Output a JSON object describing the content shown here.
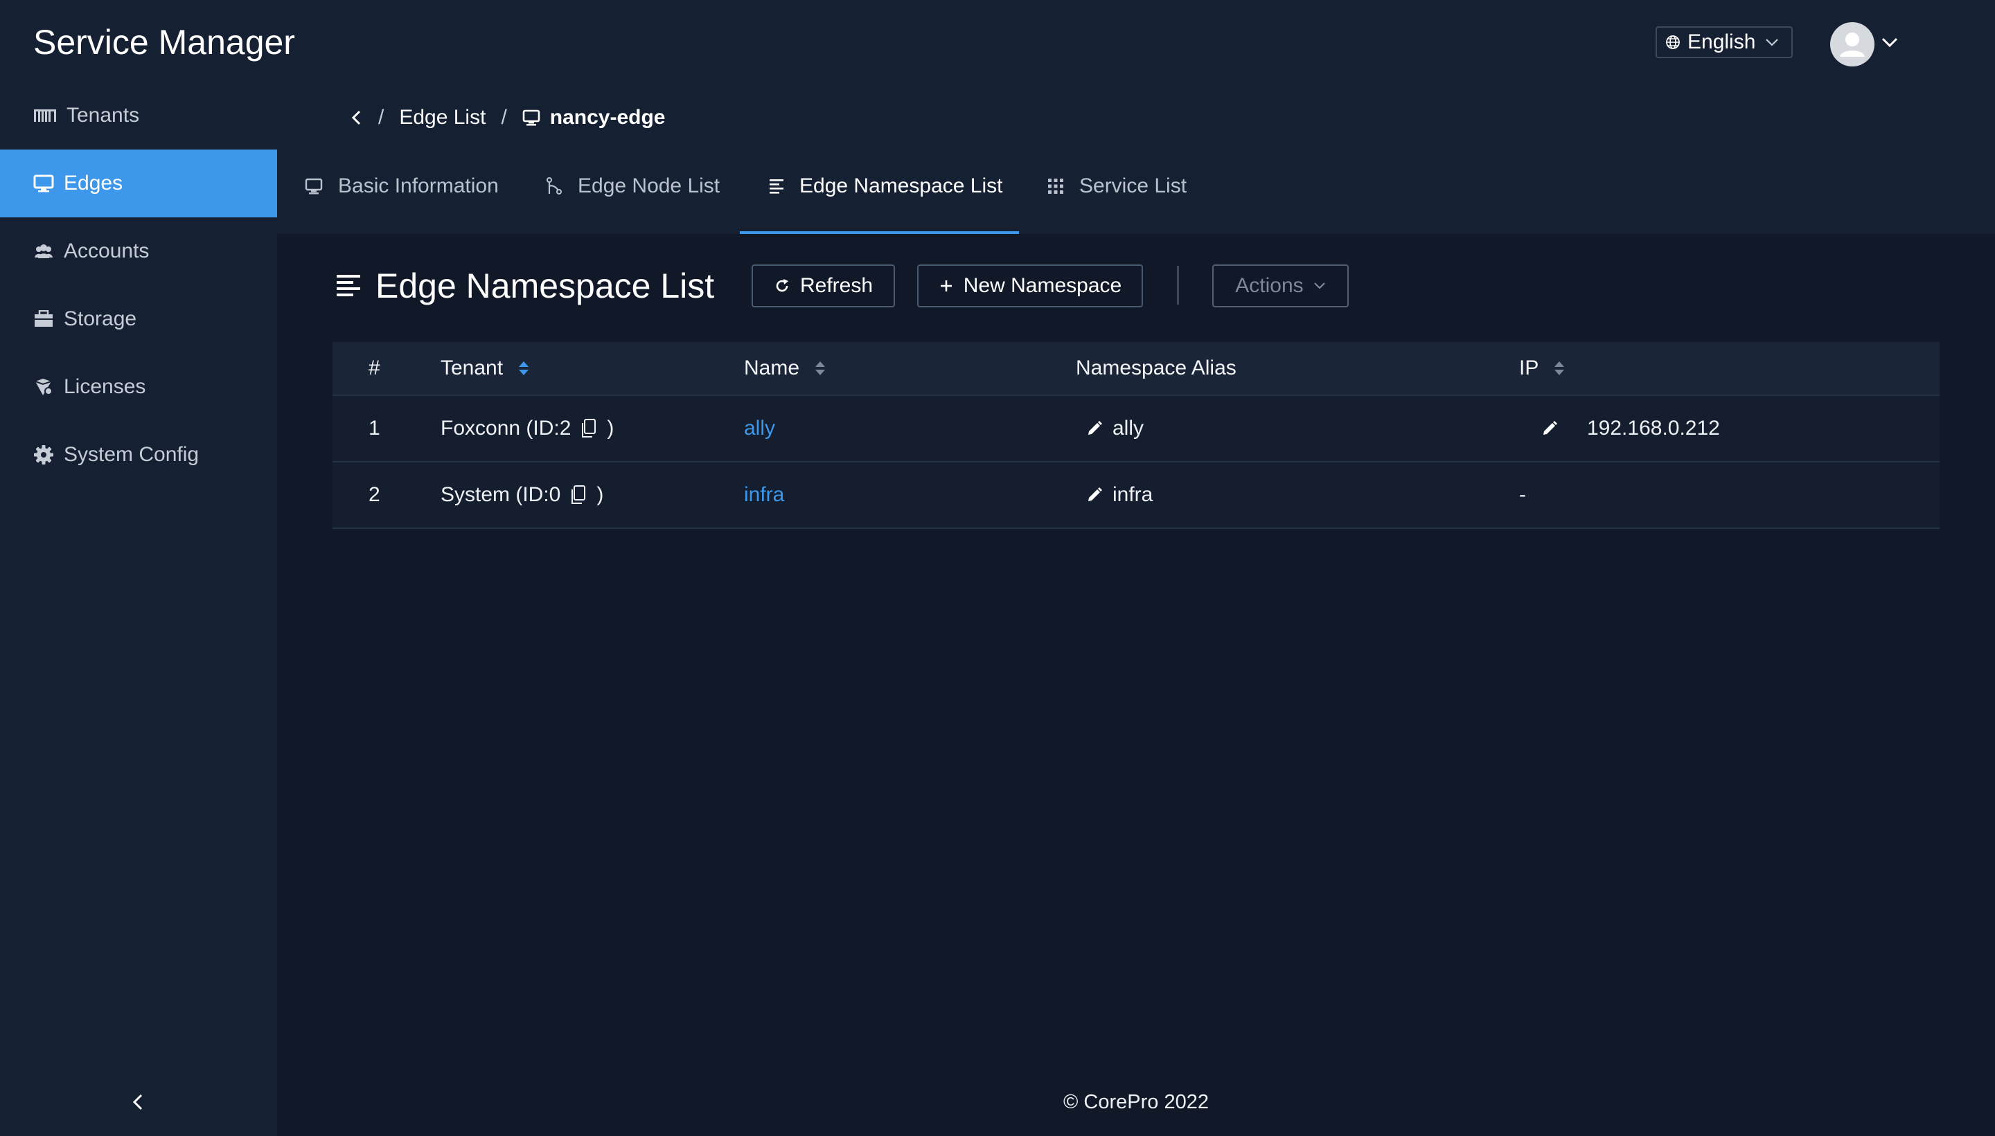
{
  "app": {
    "title": "Service Manager"
  },
  "header": {
    "language": "English"
  },
  "sidebar": {
    "items": [
      {
        "label": "Tenants",
        "icon": "tenants-icon"
      },
      {
        "label": "Edges",
        "icon": "monitor-icon",
        "active": true
      },
      {
        "label": "Accounts",
        "icon": "users-icon"
      },
      {
        "label": "Storage",
        "icon": "storage-icon"
      },
      {
        "label": "Licenses",
        "icon": "licenses-icon"
      },
      {
        "label": "System Config",
        "icon": "gear-icon"
      }
    ]
  },
  "breadcrumb": {
    "parent": "Edge List",
    "separator": "/",
    "current": "nancy-edge"
  },
  "tabs": [
    {
      "label": "Basic Information"
    },
    {
      "label": "Edge Node List"
    },
    {
      "label": "Edge Namespace List",
      "active": true
    },
    {
      "label": "Service List"
    }
  ],
  "page": {
    "heading": "Edge Namespace List"
  },
  "toolbar": {
    "refresh_label": "Refresh",
    "new_label": "New Namespace",
    "actions_label": "Actions"
  },
  "table": {
    "columns": [
      "#",
      "Tenant",
      "Name",
      "Namespace Alias",
      "IP"
    ],
    "rows": [
      {
        "index": "1",
        "tenant": "Foxconn (ID:2",
        "tenant_close": ")",
        "name": "ally",
        "alias": "ally",
        "ip": "192.168.0.212"
      },
      {
        "index": "2",
        "tenant": "System (ID:0",
        "tenant_close": ")",
        "name": "infra",
        "alias": "infra",
        "ip": "-"
      }
    ]
  },
  "footer": {
    "text": "© CorePro 2022"
  },
  "colors": {
    "accent": "#3d97ea",
    "background": "#111827",
    "panel": "#152032"
  }
}
